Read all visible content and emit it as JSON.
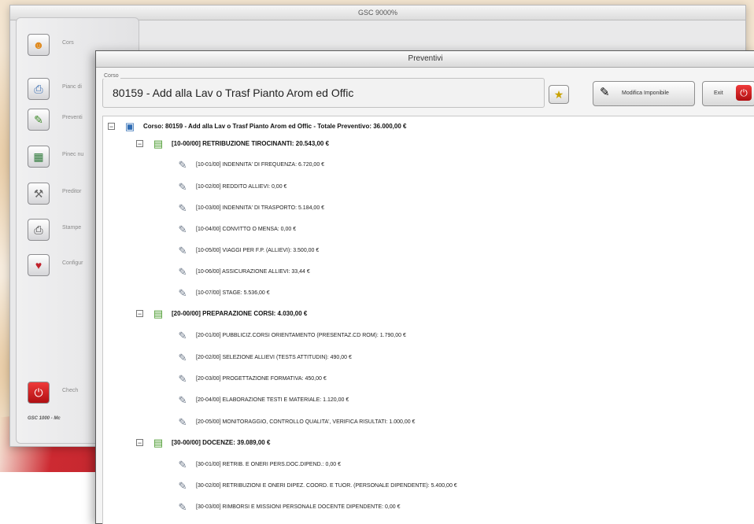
{
  "back_window": {
    "title": "GSC 9000%",
    "sidebar": [
      {
        "label": "Cors",
        "icon": "people-icon"
      },
      {
        "label": "Pianc di",
        "icon": "printer-icon"
      },
      {
        "label": "Preventi",
        "icon": "pen-icon"
      },
      {
        "label": "Pinec nu",
        "icon": "calendar-icon"
      },
      {
        "label": "Preditor",
        "icon": "tools-icon"
      },
      {
        "label": "Stampe",
        "icon": "printer2-icon"
      },
      {
        "label": "Configur",
        "icon": "config-icon"
      }
    ],
    "exit_label": "Chech",
    "footer": "GSC 1000 - Mc"
  },
  "window": {
    "title": "Preventivi",
    "course_legend": "Corso",
    "course_value": "80159 - Add alla Lav o Trasf Pianto Arom ed Offic",
    "modify_label": "Modifica Imponibile",
    "exit_label": "Exit"
  },
  "tree": {
    "root": "Corso: 80159 - Add alla Lav o Trasf Pianto Arom ed Offic - Totale Preventivo: 36.000,00 €",
    "categories": [
      {
        "label": "[10-00/00] RETRIBUZIONE TIROCINANTI: 20.543,00 €",
        "items": [
          "[10-01/00] INDENNITA' DI FREQUENZA: 6.720,00 €",
          "[10-02/00] REDDITO ALLIEVI: 0,00 €",
          "[10-03/00] INDENNITA' DI TRASPORTO: 5.184,00 €",
          "[10-04/00] CONVITTO O MENSA: 0,00 €",
          "[10-05/00] VIAGGI PER F.P. (ALLIEVI): 3.500,00 €",
          "[10-06/00] ASSICURAZIONE ALLIEVI: 33,44 €",
          "[10-07/00] STAGE: 5.536,00 €"
        ]
      },
      {
        "label": "[20-00/00] PREPARAZIONE CORSI: 4.030,00 €",
        "items": [
          "[20-01/00] PUBBLICIZ.CORSI ORIENTAMENTO (PRESENTAZ.CD ROM): 1.790,00 €",
          "[20-02/00] SELEZIONE ALLIEVI (TESTS ATTITUDIN): 490,00 €",
          "[20-03/00] PROGETTAZIONE FORMATIVA: 450,00 €",
          "[20-04/00] ELABORAZIONE TESTI E MATERIALE: 1.120,00 €",
          "[20-05/00] MONITORAGGIO, CONTROLLO QUALITA', VERIFICA RISULTATI: 1.000,00 €"
        ]
      },
      {
        "label": "[30-00/00] DOCENZE: 39.089,00 €",
        "items": [
          "[30-01/00] RETRIB. E ONERI PERS.DOC.DIPEND.: 0,00 €",
          "[30-02/00] RETRIBUZIONI E ONERI DIPEZ. COORD. E TUOR. (PERSONALE DIPENDENTE): 5.400,00 €",
          "[30-03/00] RIMBORSI E MISSIONI PERSONALE DOCENTE DIPENDENTE: 0,00 €"
        ]
      }
    ]
  }
}
